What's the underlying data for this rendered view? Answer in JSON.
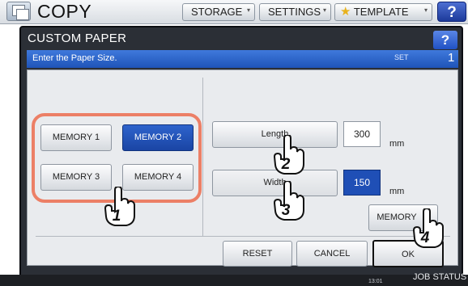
{
  "topbar": {
    "title": "COPY",
    "tabs": [
      {
        "label": "STORAGE"
      },
      {
        "label": "SETTINGS"
      },
      {
        "label": "TEMPLATE"
      }
    ],
    "help": "?"
  },
  "dialog": {
    "title": "CUSTOM PAPER",
    "help": "?",
    "message": "Enter the Paper Size.",
    "set_label": "SET",
    "set_number": "1"
  },
  "memory_buttons": [
    {
      "label": "MEMORY 1",
      "selected": false
    },
    {
      "label": "MEMORY 2",
      "selected": true
    },
    {
      "label": "MEMORY 3",
      "selected": false
    },
    {
      "label": "MEMORY 4",
      "selected": false
    }
  ],
  "length": {
    "label": "Length",
    "value": "300",
    "unit": "mm"
  },
  "width": {
    "label": "Width",
    "value": "150",
    "unit": "mm"
  },
  "memory_save_label": "MEMORY",
  "footer": {
    "reset": "RESET",
    "cancel": "CANCEL",
    "ok": "OK"
  },
  "callouts": [
    "1",
    "2",
    "3",
    "4"
  ],
  "status": {
    "time": "13:01",
    "job_status": "JOB STATUS"
  },
  "colors": {
    "accent_blue": "#1f54b8",
    "highlight": "#ec7f66"
  }
}
